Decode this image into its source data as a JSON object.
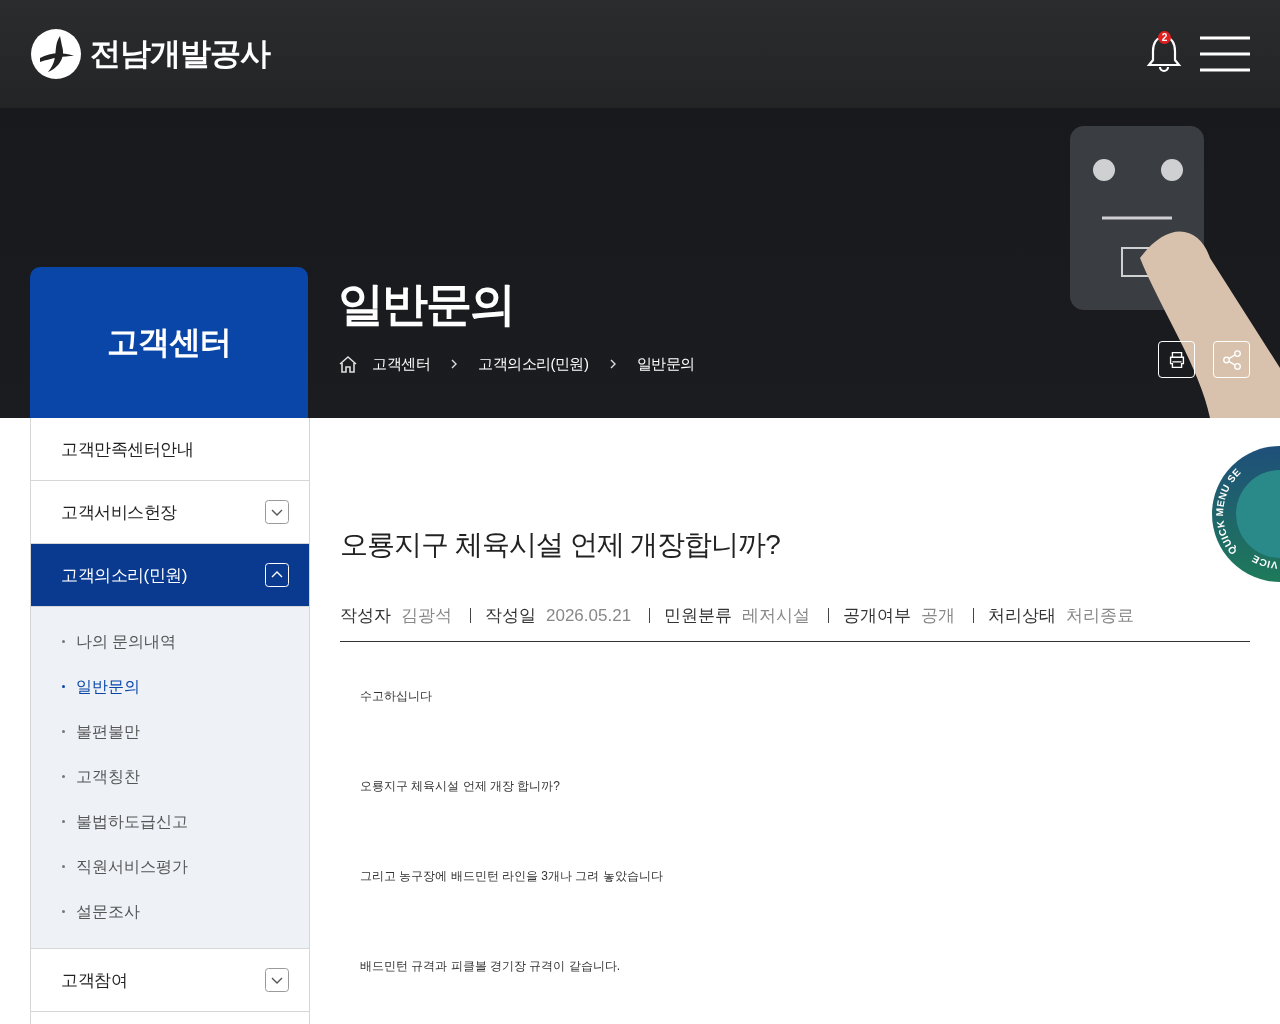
{
  "header": {
    "logo_text": "전남개발공사",
    "notification_count": "2"
  },
  "hero": {
    "section_title": "고객센터",
    "page_title": "일반문의",
    "breadcrumb": [
      "고객센터",
      "고객의소리(민원)",
      "일반문의"
    ]
  },
  "sidebar": {
    "items": [
      {
        "label": "고객만족센터안내",
        "expandable": false,
        "selected": false
      },
      {
        "label": "고객서비스헌장",
        "expandable": true,
        "expanded": false,
        "selected": false
      },
      {
        "label": "고객의소리(민원)",
        "expandable": true,
        "expanded": true,
        "selected": true,
        "children": [
          {
            "label": "나의 문의내역",
            "selected": false
          },
          {
            "label": "일반문의",
            "selected": true
          },
          {
            "label": "불편불만",
            "selected": false
          },
          {
            "label": "고객칭찬",
            "selected": false
          },
          {
            "label": "불법하도급신고",
            "selected": false
          },
          {
            "label": "직원서비스평가",
            "selected": false
          },
          {
            "label": "설문조사",
            "selected": false
          }
        ]
      },
      {
        "label": "고객참여",
        "expandable": true,
        "expanded": false,
        "selected": false
      }
    ]
  },
  "post": {
    "title": "오룡지구 체육시설 언제 개장합니까?",
    "meta": [
      {
        "label": "작성자",
        "value": "김광석"
      },
      {
        "label": "작성일",
        "value": "2026.05.21"
      },
      {
        "label": "민원분류",
        "value": "레저시설"
      },
      {
        "label": "공개여부",
        "value": "공개"
      },
      {
        "label": "처리상태",
        "value": "처리종료"
      }
    ],
    "body": [
      "수고하십니다",
      "오룡지구 체육시설 언제 개장 합니까?",
      "그리고 농구장에 배드민턴 라인을 3개나 그려 놓았습니다",
      "배드민턴 규격과 피클볼 경기장 규격이 같습니다."
    ]
  },
  "quick_menu": {
    "top_text": "QUICK MENU SE",
    "bottom_text": "VICE"
  }
}
